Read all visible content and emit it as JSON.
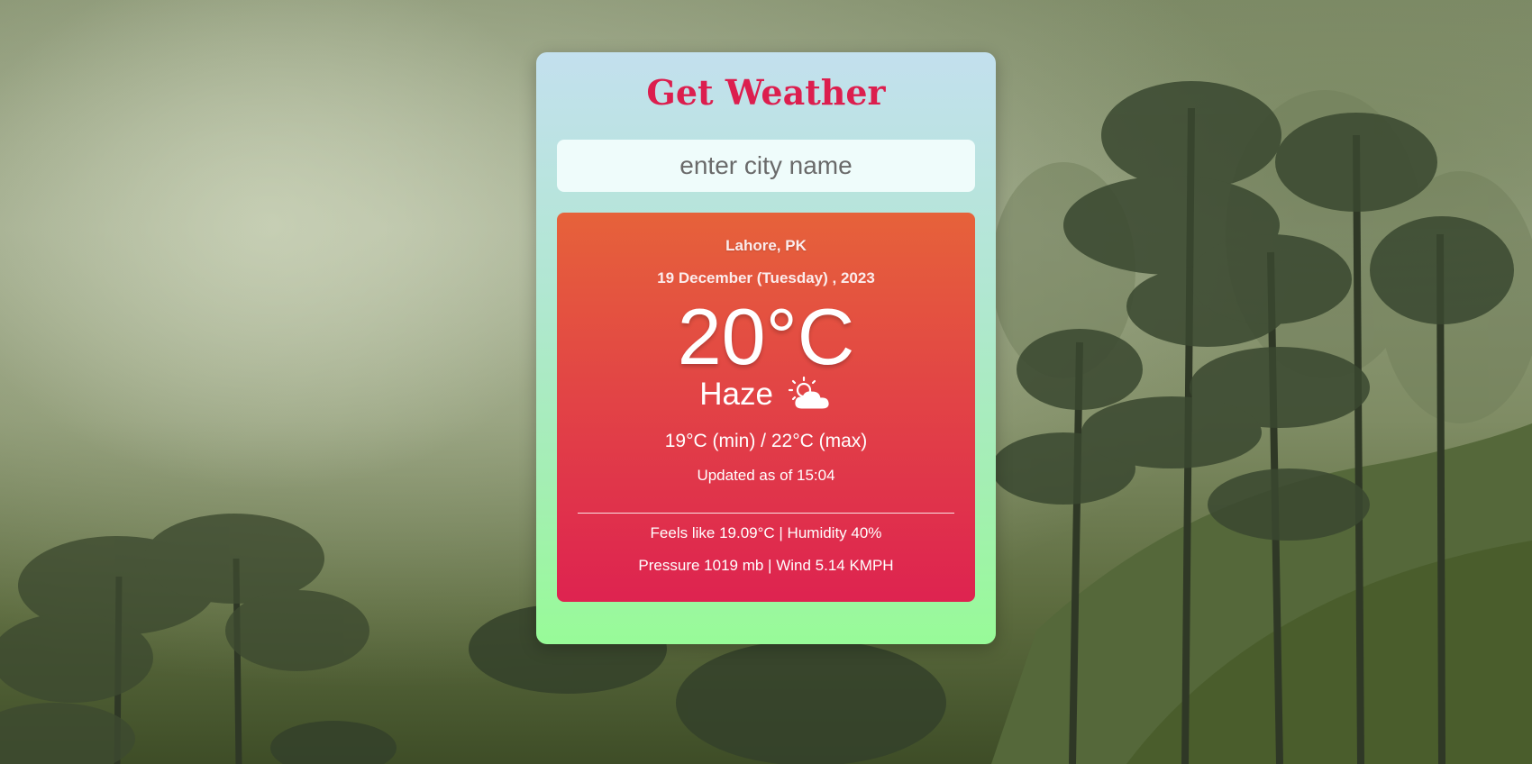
{
  "app": {
    "title": "Get Weather"
  },
  "search": {
    "placeholder": "enter city name",
    "value": ""
  },
  "weather": {
    "location": "Lahore, PK",
    "date": "19 December (Tuesday) , 2023",
    "temperature": "20°C",
    "condition": "Haze",
    "condition_icon": "sun-behind-cloud-icon",
    "min_max": "19°C (min) / 22°C (max)",
    "updated": "Updated as of 15:04",
    "feels_humidity": "Feels like 19.09°C | Humidity 40%",
    "pressure_wind": "Pressure 1019 mb | Wind 5.14 KMPH"
  },
  "colors": {
    "title": "#dc1e4e",
    "panel_top": "#e6623a",
    "panel_bottom": "#de2350",
    "card_top": "#c3e0ee",
    "card_bottom": "#98fb98"
  }
}
